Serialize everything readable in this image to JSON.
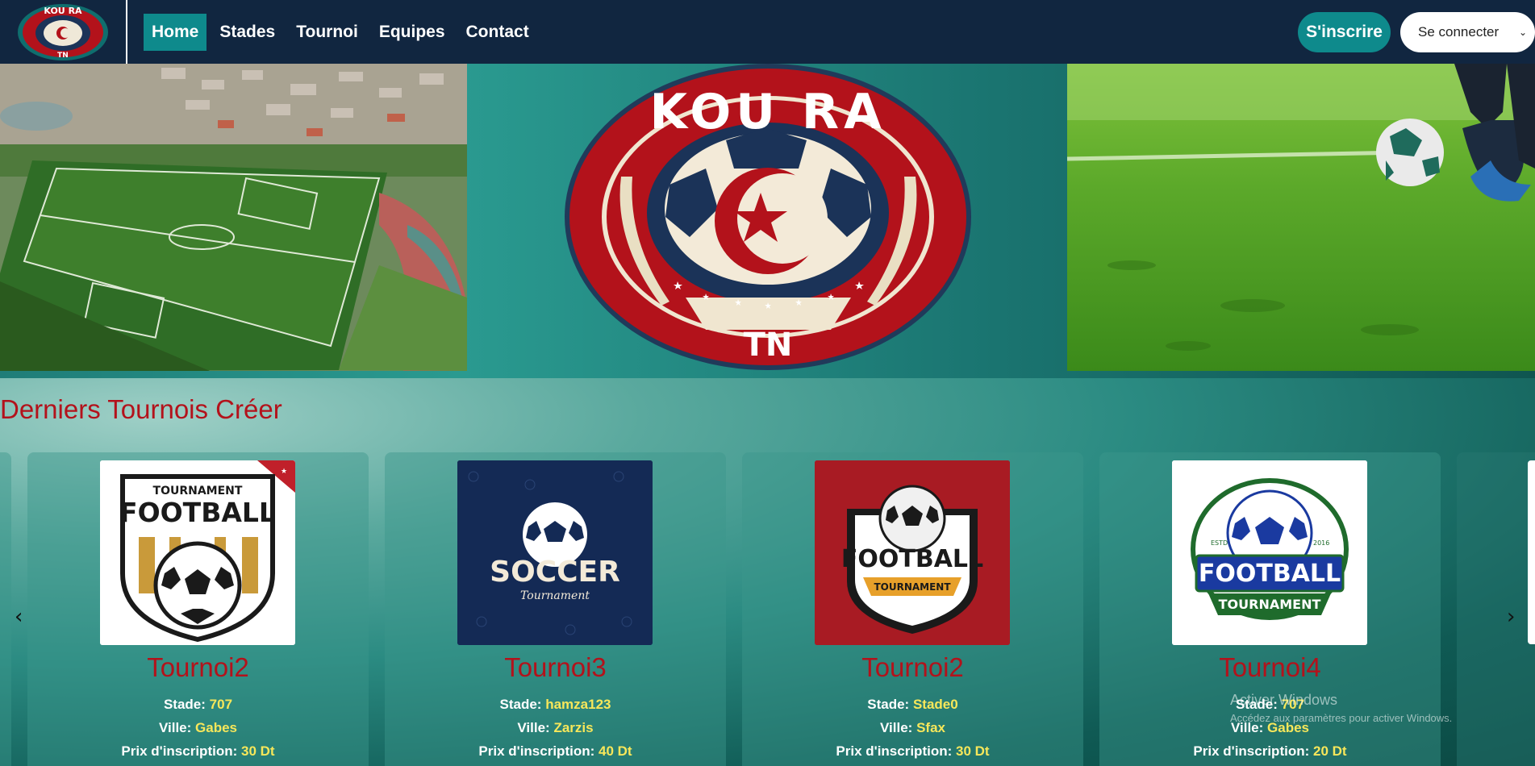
{
  "nav": {
    "logo_top_text": "KOU RA",
    "logo_bottom_text": "TN",
    "links": [
      "Home",
      "Stades",
      "Tournoi",
      "Equipes",
      "Contact"
    ],
    "signup_label": "S'inscrire",
    "login_label": "Se connecter"
  },
  "hero": {
    "logo_top_text": "KOU RA",
    "logo_bottom_text": "TN"
  },
  "section": {
    "title": "Derniers Tournois Créer"
  },
  "labels": {
    "stade": "Stade:",
    "ville": "Ville:",
    "prix": "Prix d'inscription:"
  },
  "cards": [
    {
      "name": "Tournoi2",
      "stade": "707",
      "ville": "Gabes",
      "prix": "30 Dt",
      "logo_text_top": "TOURNAMENT",
      "logo_text_main": "FOOTBALL",
      "corner_badge": "★"
    },
    {
      "name": "Tournoi3",
      "stade": "hamza123",
      "ville": "Zarzis",
      "prix": "40 Dt",
      "logo_text_main": "SOCCER",
      "logo_text_sub": "Tournament"
    },
    {
      "name": "Tournoi2",
      "stade": "Stade0",
      "ville": "Sfax",
      "prix": "30 Dt",
      "logo_text_main": "FOOTBALL",
      "logo_text_sub": "TOURNAMENT"
    },
    {
      "name": "Tournoi4",
      "stade": "707",
      "ville": "Gabes",
      "prix": "20 Dt",
      "logo_text_main": "FOOTBALL",
      "logo_text_sub": "TOURNAMENT",
      "logo_estd": "ESTD",
      "logo_year": "2016"
    }
  ],
  "watermark": {
    "line1": "Activer Windows",
    "line2": "Accédez aux paramètres pour activer Windows."
  },
  "colors": {
    "nav_bg": "#112640",
    "accent_teal": "#0e8a8c",
    "title_red": "#b3121b",
    "value_yellow": "#f7e75a"
  }
}
